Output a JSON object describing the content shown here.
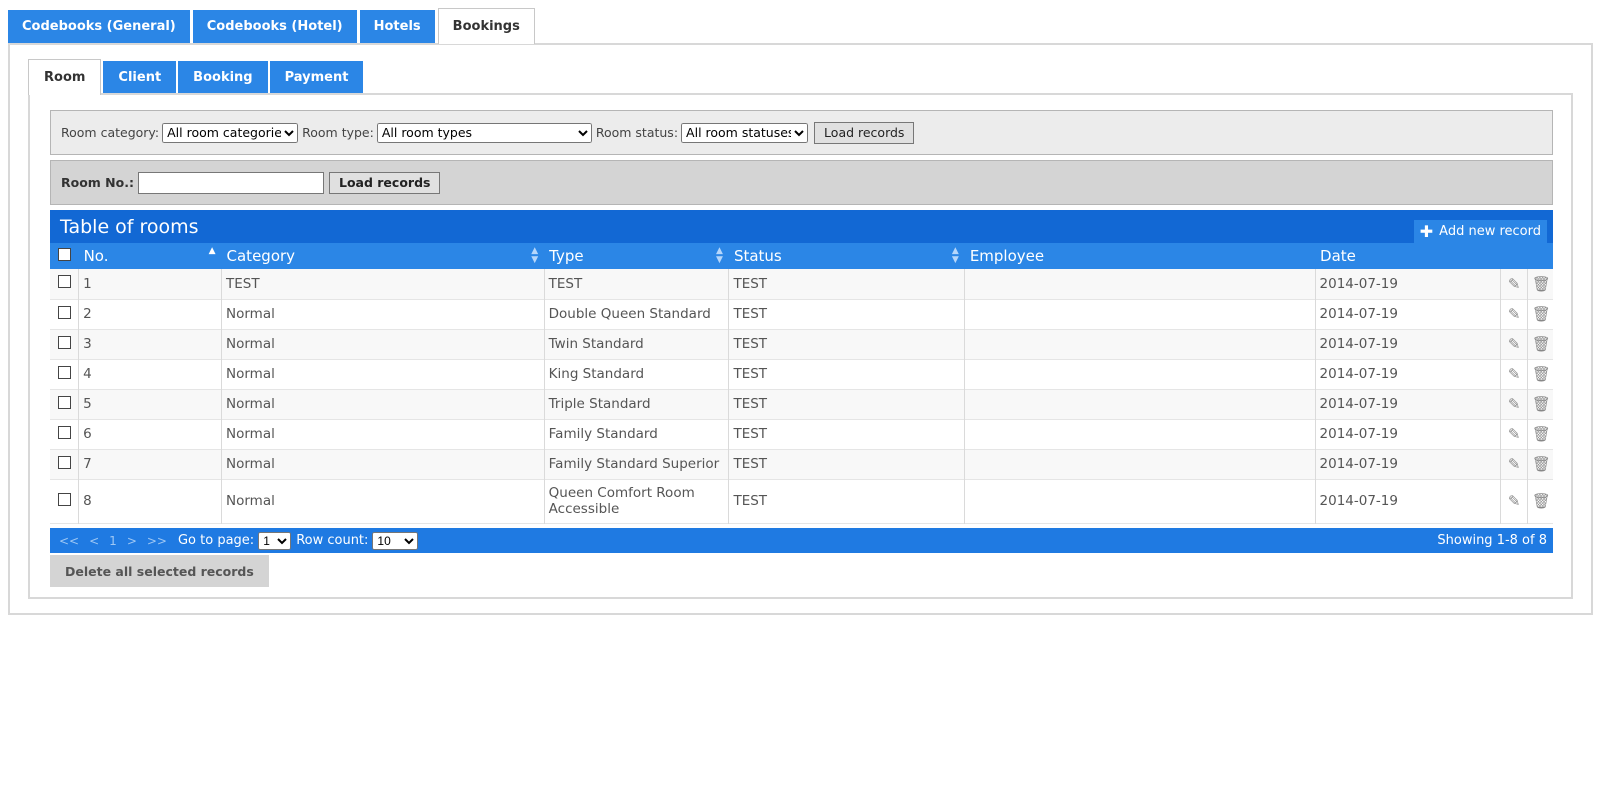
{
  "outer_tabs": [
    "Codebooks (General)",
    "Codebooks (Hotel)",
    "Hotels",
    "Bookings"
  ],
  "inner_tabs": [
    "Room",
    "Client",
    "Booking",
    "Payment"
  ],
  "filters": {
    "category_label": "Room category:",
    "category_value": "All room categories",
    "type_label": "Room type:",
    "type_value": "All room types",
    "status_label": "Room status:",
    "status_value": "All room statuses",
    "load_label": "Load records",
    "room_no_label": "Room No.:",
    "room_no_value": "",
    "load2_label": "Load records"
  },
  "table": {
    "title": "Table of rooms",
    "add_label": "Add new record",
    "columns": [
      "No.",
      "Category",
      "Type",
      "Status",
      "Employee",
      "Date"
    ],
    "rows": [
      [
        "1",
        "TEST",
        "TEST",
        "TEST",
        "",
        "2014-07-19"
      ],
      [
        "2",
        "Normal",
        "Double Queen Standard",
        "TEST",
        "",
        "2014-07-19"
      ],
      [
        "3",
        "Normal",
        "Twin Standard",
        "TEST",
        "",
        "2014-07-19"
      ],
      [
        "4",
        "Normal",
        "King Standard",
        "TEST",
        "",
        "2014-07-19"
      ],
      [
        "5",
        "Normal",
        "Triple Standard",
        "TEST",
        "",
        "2014-07-19"
      ],
      [
        "6",
        "Normal",
        "Family Standard",
        "TEST",
        "",
        "2014-07-19"
      ],
      [
        "7",
        "Normal",
        "Family Standard Superior",
        "TEST",
        "",
        "2014-07-19"
      ],
      [
        "8",
        "Normal",
        "Queen Comfort Room Accessible",
        "TEST",
        "",
        "2014-07-19"
      ]
    ]
  },
  "pager": {
    "first": "<<",
    "prev": "<",
    "page": "1",
    "next": ">",
    "last": ">>",
    "goto_label": "Go to page:",
    "goto_value": "1",
    "rowcount_label": "Row count:",
    "rowcount_value": "10",
    "showing": "Showing 1-8 of 8"
  },
  "delete_label": "Delete all selected records",
  "icons": {
    "add": "plus-icon",
    "edit": "edit-icon",
    "delete": "trash-icon",
    "sort": "sort-icon"
  }
}
